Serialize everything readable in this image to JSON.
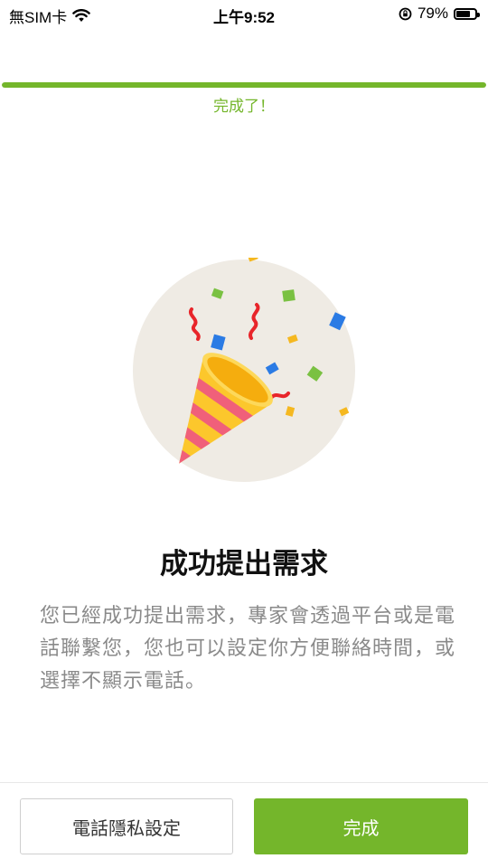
{
  "status_bar": {
    "carrier": "無SIM卡",
    "time": "上午9:52",
    "battery_percent": "79%",
    "battery_level": 0.79
  },
  "progress": {
    "value": 1.0,
    "label": "完成了！",
    "color": "#74b62b"
  },
  "illustration": {
    "icon": "party-popper-icon"
  },
  "main": {
    "title": "成功提出需求",
    "description": "您已經成功提出需求，專家會透過平台或是電話聯繫您，您也可以設定你方便聯絡時間，或選擇不顯示電話。"
  },
  "actions": {
    "secondary_label": "電話隱私設定",
    "primary_label": "完成",
    "primary_color": "#74b62b"
  }
}
